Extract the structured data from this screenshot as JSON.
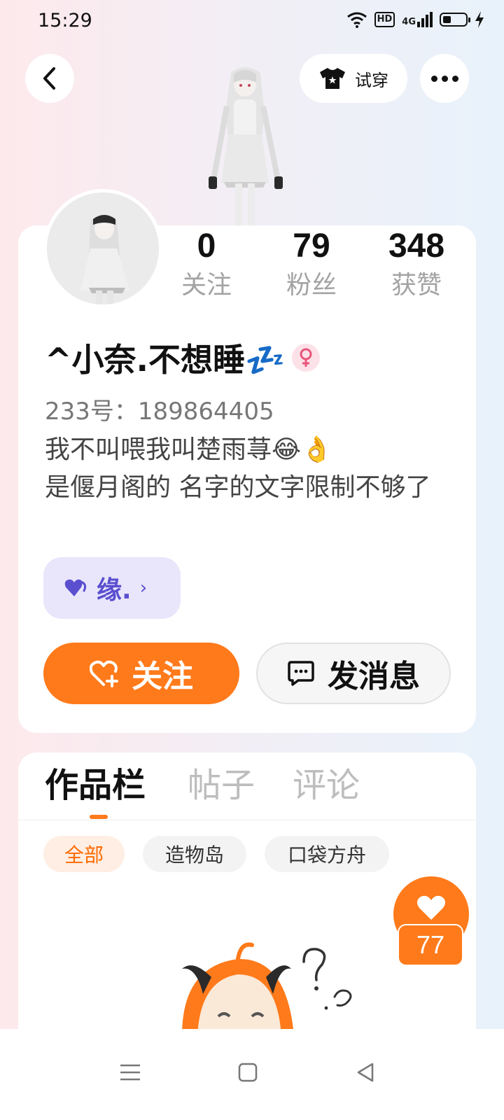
{
  "status_bar": {
    "time": "15:29",
    "hd_label": "HD",
    "network_label": "4G",
    "battery_level": 0.35,
    "icons": [
      "wifi-icon",
      "hd-icon",
      "signal-icon",
      "battery-icon",
      "charging-icon"
    ]
  },
  "header": {
    "back_icon": "chevron-left-icon",
    "tryon_label": "试穿",
    "tryon_icon": "shirt-icon",
    "more_icon": "more-dots-icon"
  },
  "stats": [
    {
      "value": "0",
      "label": "关注"
    },
    {
      "value": "79",
      "label": "粉丝"
    },
    {
      "value": "348",
      "label": "获赞"
    }
  ],
  "profile": {
    "username": "^小奈.不想睡💤",
    "gender_icon": "female-icon",
    "uid": "233号：189864405",
    "bio_line1": "我不叫喂我叫楚雨荨😂👌",
    "bio_line2": "是偃月阁的 名字的文字限制不够了"
  },
  "fate_chip": {
    "label": "缘.",
    "icon": "heart-icon",
    "arrow": "›"
  },
  "actions": {
    "follow_label": "关注",
    "follow_icon": "heart-plus-icon",
    "message_label": "发消息",
    "message_icon": "chat-bubble-icon"
  },
  "tabs": [
    {
      "label": "作品栏",
      "active": true
    },
    {
      "label": "帖子",
      "active": false
    },
    {
      "label": "评论",
      "active": false
    }
  ],
  "filters": [
    {
      "label": "全部",
      "active": true
    },
    {
      "label": "造物岛",
      "active": false
    },
    {
      "label": "口袋方舟",
      "active": false
    }
  ],
  "like_fab": {
    "icon": "heart-icon",
    "count": "77"
  },
  "nav": {
    "menu_icon": "menu-icon",
    "home_icon": "home-square-icon",
    "back_icon": "back-triangle-icon"
  },
  "colors": {
    "accent": "#ff7a1a",
    "fate_purple": "#5a4fcf",
    "fate_bg": "#e9e6fb",
    "gender_pink": "#e8557a"
  }
}
